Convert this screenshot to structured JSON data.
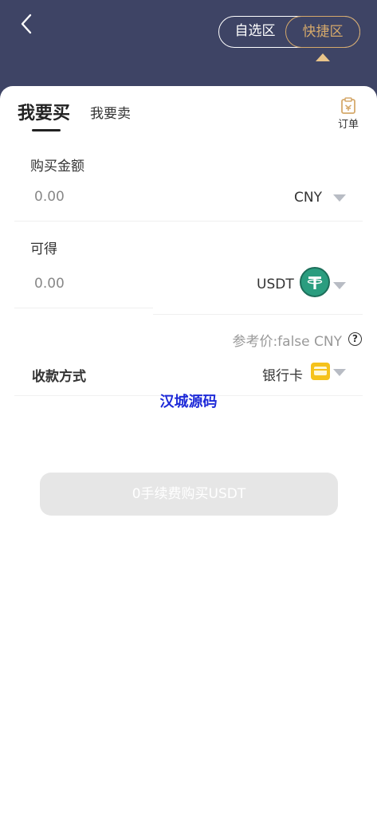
{
  "header": {
    "segments": [
      "自选区",
      "快捷区"
    ],
    "active_segment": "快捷区"
  },
  "tabs": {
    "buy": "我要买",
    "sell": "我要卖",
    "active": "我要买"
  },
  "order": {
    "label": "订单"
  },
  "form": {
    "amount": {
      "label": "购买金额",
      "value": "0.00",
      "currency": "CNY"
    },
    "receive": {
      "label": "可得",
      "value": "0.00",
      "currency": "USDT"
    },
    "reference_price": "参考价:false CNY",
    "payment": {
      "label": "收款方式",
      "value": "银行卡"
    }
  },
  "watermark": "汉城源码",
  "buy_button": "0手续费购买USDT",
  "colors": {
    "header_bg": "#3e4465",
    "accent": "#d5a96b",
    "usdt_green": "#2a9d7f",
    "bank_card_yellow": "#f5c21b",
    "watermark_blue": "#1e2ad8"
  },
  "icons": [
    "back-icon",
    "order-icon",
    "usdt-icon",
    "help-icon",
    "bank-card-icon"
  ]
}
